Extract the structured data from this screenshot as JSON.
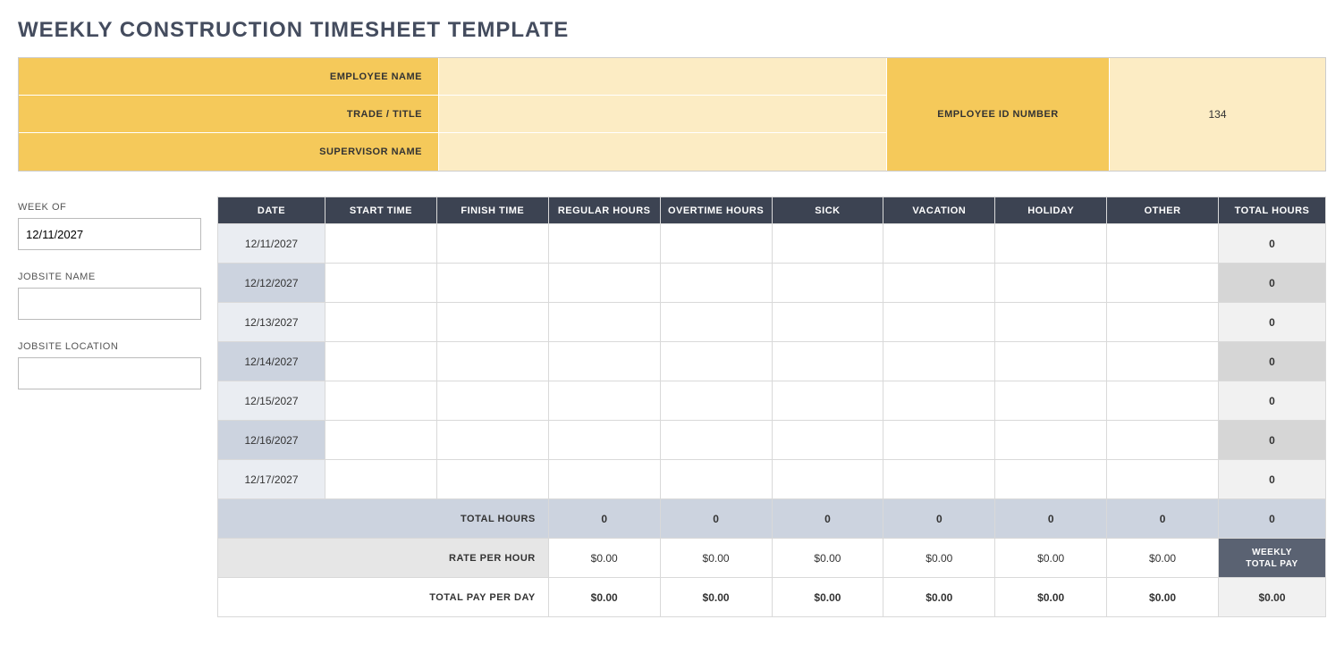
{
  "title": "WEEKLY CONSTRUCTION TIMESHEET TEMPLATE",
  "header": {
    "employee_name_label": "EMPLOYEE NAME",
    "employee_name_value": "",
    "trade_title_label": "TRADE / TITLE",
    "trade_title_value": "",
    "supervisor_name_label": "SUPERVISOR NAME",
    "supervisor_name_value": "",
    "employee_id_label": "EMPLOYEE ID NUMBER",
    "employee_id_value": "134"
  },
  "sidebar": {
    "week_of_label": "WEEK OF",
    "week_of_value": "12/11/2027",
    "jobsite_name_label": "JOBSITE NAME",
    "jobsite_name_value": "",
    "jobsite_location_label": "JOBSITE LOCATION",
    "jobsite_location_value": ""
  },
  "table": {
    "headers": {
      "date": "DATE",
      "start": "START TIME",
      "finish": "FINISH TIME",
      "regular": "REGULAR HOURS",
      "overtime": "OVERTIME HOURS",
      "sick": "SICK",
      "vacation": "VACATION",
      "holiday": "HOLIDAY",
      "other": "OTHER",
      "total": "TOTAL HOURS"
    },
    "rows": [
      {
        "date": "12/11/2027",
        "start": "",
        "finish": "",
        "regular": "",
        "overtime": "",
        "sick": "",
        "vacation": "",
        "holiday": "",
        "other": "",
        "total": "0"
      },
      {
        "date": "12/12/2027",
        "start": "",
        "finish": "",
        "regular": "",
        "overtime": "",
        "sick": "",
        "vacation": "",
        "holiday": "",
        "other": "",
        "total": "0"
      },
      {
        "date": "12/13/2027",
        "start": "",
        "finish": "",
        "regular": "",
        "overtime": "",
        "sick": "",
        "vacation": "",
        "holiday": "",
        "other": "",
        "total": "0"
      },
      {
        "date": "12/14/2027",
        "start": "",
        "finish": "",
        "regular": "",
        "overtime": "",
        "sick": "",
        "vacation": "",
        "holiday": "",
        "other": "",
        "total": "0"
      },
      {
        "date": "12/15/2027",
        "start": "",
        "finish": "",
        "regular": "",
        "overtime": "",
        "sick": "",
        "vacation": "",
        "holiday": "",
        "other": "",
        "total": "0"
      },
      {
        "date": "12/16/2027",
        "start": "",
        "finish": "",
        "regular": "",
        "overtime": "",
        "sick": "",
        "vacation": "",
        "holiday": "",
        "other": "",
        "total": "0"
      },
      {
        "date": "12/17/2027",
        "start": "",
        "finish": "",
        "regular": "",
        "overtime": "",
        "sick": "",
        "vacation": "",
        "holiday": "",
        "other": "",
        "total": "0"
      }
    ],
    "totals": {
      "label": "TOTAL HOURS",
      "regular": "0",
      "overtime": "0",
      "sick": "0",
      "vacation": "0",
      "holiday": "0",
      "other": "0",
      "total": "0"
    },
    "rate": {
      "label": "RATE PER HOUR",
      "regular": "$0.00",
      "overtime": "$0.00",
      "sick": "$0.00",
      "vacation": "$0.00",
      "holiday": "$0.00",
      "other": "$0.00",
      "weekly_label_line1": "WEEKLY",
      "weekly_label_line2": "TOTAL PAY"
    },
    "pay": {
      "label": "TOTAL PAY PER DAY",
      "regular": "$0.00",
      "overtime": "$0.00",
      "sick": "$0.00",
      "vacation": "$0.00",
      "holiday": "$0.00",
      "other": "$0.00",
      "total": "$0.00"
    }
  }
}
